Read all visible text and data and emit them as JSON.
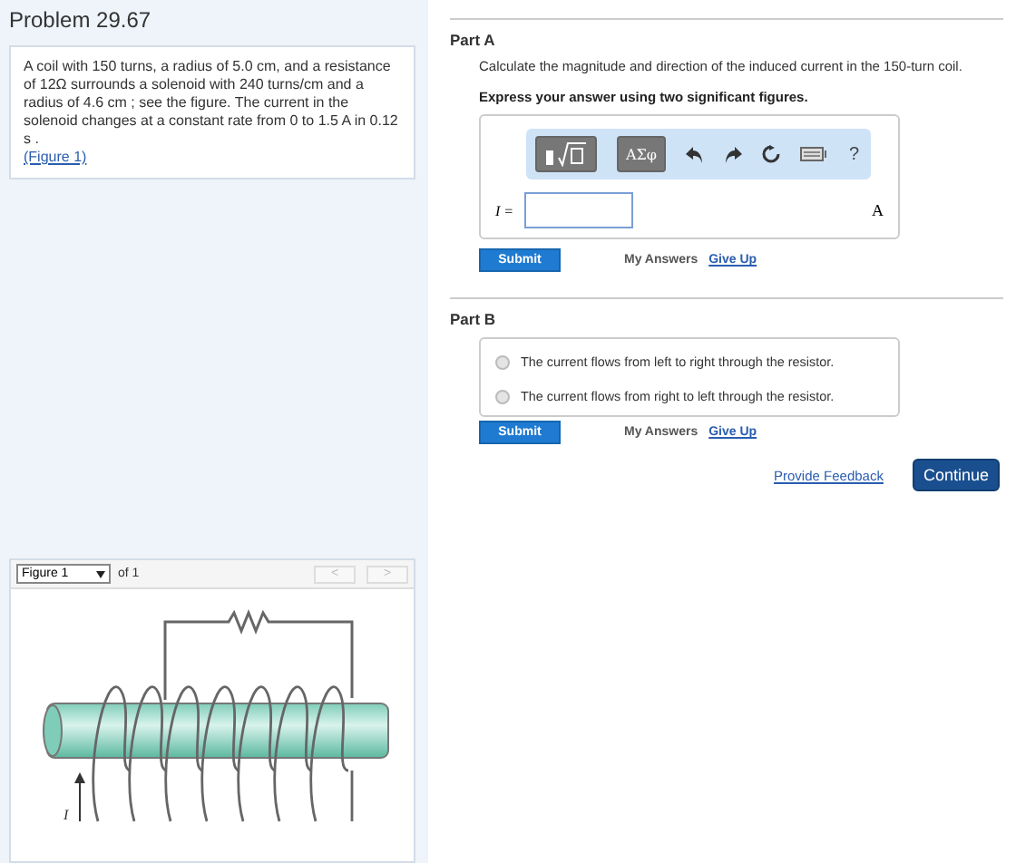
{
  "problem": {
    "title": "Problem 29.67",
    "text": "A coil with 150 turns, a radius of 5.0 cm, and a resistance of 12Ω surrounds a solenoid with 240 turns/cm and a radius of 4.6 cm ; see the figure. The current in the solenoid changes at a constant rate from 0 to 1.5 A in 0.12 s .",
    "figure_link": "(Figure 1)"
  },
  "figure_viewer": {
    "select": "Figure 1",
    "count": "of 1",
    "prev": "<",
    "next": ">",
    "current_label": "I"
  },
  "part_a": {
    "title": "Part A",
    "prompt": "Calculate the magnitude and direction of the induced current in the 150-turn coil.",
    "instruction": "Express your answer using two significant figures.",
    "symbols_button": "AΣφ",
    "help": "?",
    "variable": "I =",
    "unit": "A",
    "submit": "Submit",
    "my_answers": "My Answers",
    "give_up": "Give Up"
  },
  "part_b": {
    "title": "Part B",
    "options": [
      {
        "label": "The current flows from left to right through the resistor.",
        "selected": false
      },
      {
        "label": "The current flows from right to left through the resistor.",
        "selected": false
      }
    ],
    "submit": "Submit",
    "my_answers": "My Answers",
    "give_up": "Give Up"
  },
  "footer": {
    "feedback": "Provide Feedback",
    "continue": "Continue"
  }
}
